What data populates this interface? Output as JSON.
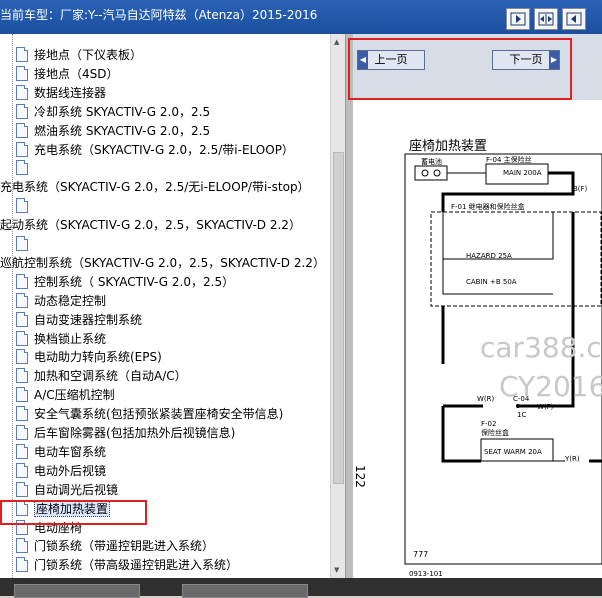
{
  "window": {
    "title": "当前车型：厂家:Y--汽马自达阿特兹（Atenza）2015-2016"
  },
  "tree": {
    "items": [
      {
        "label": "接地点（下仪表板）",
        "indent": 1
      },
      {
        "label": "接地点（4SD）",
        "indent": 1
      },
      {
        "label": "数据线连接器",
        "indent": 1
      },
      {
        "label": "冷却系统 SKYACTIV-G 2.0，2.5",
        "indent": 1
      },
      {
        "label": "燃油系统 SKYACTIV-G 2.0，2.5",
        "indent": 1
      },
      {
        "label": "充电系统（SKYACTIV-G 2.0，2.5/带i-ELOOP）",
        "indent": 1
      },
      {
        "label": "",
        "indent": 1
      },
      {
        "label": "充电系统（SKYACTIV-G 2.0，2.5/无i-ELOOP/带i-stop）",
        "indent": 0
      },
      {
        "label": "",
        "indent": 1
      },
      {
        "label": "起动系统（SKYACTIV-G 2.0，2.5，SKYACTIV-D 2.2）",
        "indent": 0
      },
      {
        "label": "",
        "indent": 1
      },
      {
        "label": "巡航控制系统（SKYACTIV-G 2.0，2.5，SKYACTIV-D 2.2）",
        "indent": 0
      },
      {
        "label": "控制系统（ SKYACTIV-G 2.0，2.5）",
        "indent": 1
      },
      {
        "label": "动态稳定控制",
        "indent": 1
      },
      {
        "label": "自动变速器控制系统",
        "indent": 1
      },
      {
        "label": "换档锁止系统",
        "indent": 1
      },
      {
        "label": "电动助力转向系统(EPS)",
        "indent": 1
      },
      {
        "label": "加热和空调系统（自动A/C）",
        "indent": 1
      },
      {
        "label": "A/C压缩机控制",
        "indent": 1
      },
      {
        "label": "安全气囊系统(包括预张紧装置座椅安全带信息)",
        "indent": 1
      },
      {
        "label": "后车窗除雾器(包括加热外后视镜信息)",
        "indent": 1
      },
      {
        "label": "电动车窗系统",
        "indent": 1
      },
      {
        "label": "电动外后视镜",
        "indent": 1
      },
      {
        "label": "自动调光后视镜",
        "indent": 1
      },
      {
        "label": "座椅加热装置",
        "indent": 1,
        "selected": true
      },
      {
        "label": "电动座椅",
        "indent": 1
      },
      {
        "label": "门锁系统（带遥控钥匙进入系统）",
        "indent": 1
      },
      {
        "label": "门锁系统（带高级遥控钥匙进入系统）",
        "indent": 1
      }
    ]
  },
  "nav": {
    "prev_label": "上一页",
    "next_label": "下一页"
  },
  "diagram": {
    "title": "座椅加热装置",
    "page_number": "122",
    "battery_label": "蓄电池",
    "f04_label": "F-04 主保险丝",
    "main_fuse": "MAIN 200A",
    "bf_label": "B(F)",
    "f01_label": "F-01 继电器和保险丝盒",
    "hazard_fuse": "HAZARD 25A",
    "cabin_fuse": "CABIN +B 50A",
    "wr_label": "W(R)",
    "c04_label": "C-04",
    "c1c_label": "1C",
    "wf_label": "W(F)",
    "f02_label": "F-02",
    "f02_sub": "保险丝盒",
    "seat_fuse": "SEAT WARM 20A",
    "yr_label": "Y(R)",
    "page_code": "0913-101"
  },
  "watermark": {
    "line1": "car388.co",
    "line2": "CY2016"
  },
  "colors": {
    "title_bg": "#1f56a8",
    "highlight_box": "#e02020",
    "selection_bg": "#dde8ff"
  }
}
